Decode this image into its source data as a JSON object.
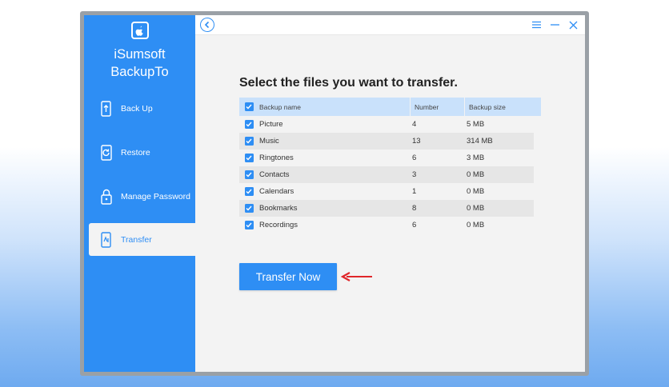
{
  "app": {
    "name_line1": "iSumsoft",
    "name_line2": "BackupTo"
  },
  "sidebar": {
    "items": [
      {
        "label": "Back Up",
        "icon": "backup-icon"
      },
      {
        "label": "Restore",
        "icon": "restore-icon"
      },
      {
        "label": "Manage Password",
        "icon": "lock-icon"
      },
      {
        "label": "Transfer",
        "icon": "transfer-icon",
        "active": true
      }
    ]
  },
  "window_controls": [
    "menu-icon",
    "minimize-icon",
    "close-icon"
  ],
  "main": {
    "heading": "Select the files you want to transfer.",
    "table": {
      "headers": {
        "name": "Backup name",
        "number": "Number",
        "size": "Backup size"
      },
      "rows": [
        {
          "name": "Picture",
          "number": "4",
          "size": "5 MB",
          "checked": true
        },
        {
          "name": "Music",
          "number": "13",
          "size": "314 MB",
          "checked": true
        },
        {
          "name": "Ringtones",
          "number": "6",
          "size": "3 MB",
          "checked": true
        },
        {
          "name": "Contacts",
          "number": "3",
          "size": "0 MB",
          "checked": true
        },
        {
          "name": "Calendars",
          "number": "1",
          "size": "0 MB",
          "checked": true
        },
        {
          "name": "Bookmarks",
          "number": "8",
          "size": "0 MB",
          "checked": true
        },
        {
          "name": "Recordings",
          "number": "6",
          "size": "0 MB",
          "checked": true
        }
      ]
    },
    "transfer_button": "Transfer Now"
  },
  "colors": {
    "accent": "#2e8ef4",
    "header_row": "#c9e1fb",
    "arrow": "#e0262a"
  }
}
